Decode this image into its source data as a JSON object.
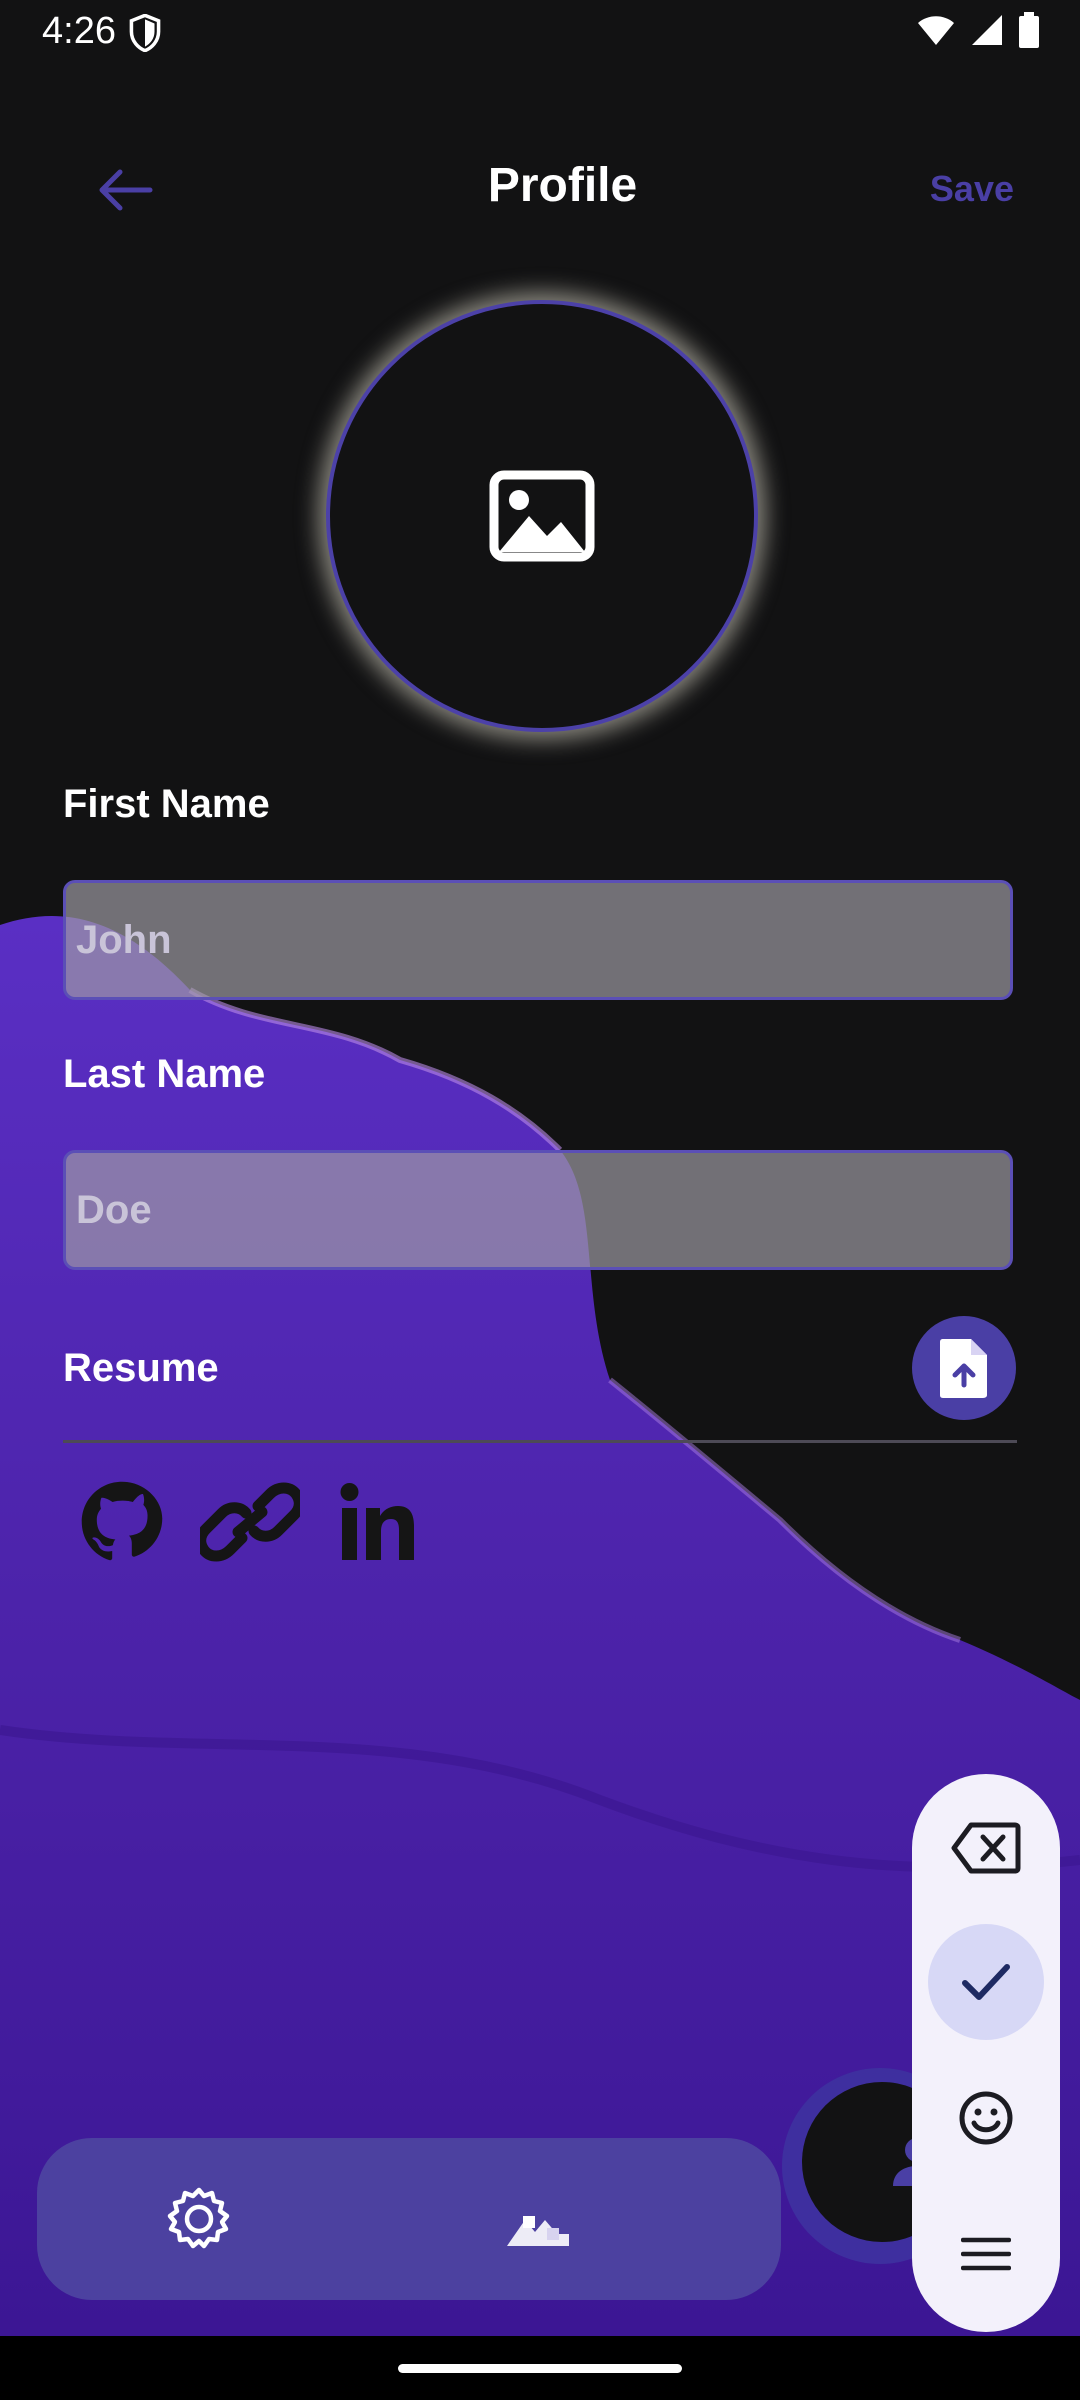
{
  "status_bar": {
    "time": "4:26"
  },
  "header": {
    "title": "Profile",
    "save_label": "Save"
  },
  "form": {
    "first_name_label": "First Name",
    "first_name_value": "John",
    "last_name_label": "Last Name",
    "last_name_value": "Doe",
    "resume_label": "Resume"
  },
  "social_icons": [
    "github-icon",
    "link-icon",
    "linkedin-icon"
  ],
  "bottom_nav": {
    "items": [
      "settings-icon",
      "stairs-icon",
      "person-icon"
    ]
  },
  "side_menu": {
    "items": [
      "backspace-icon",
      "check-icon",
      "smile-icon",
      "menu-icon"
    ],
    "active": "check-icon"
  },
  "colors": {
    "accent": "#4a3fa5",
    "background": "#121213",
    "wave": "#4b22a8"
  }
}
